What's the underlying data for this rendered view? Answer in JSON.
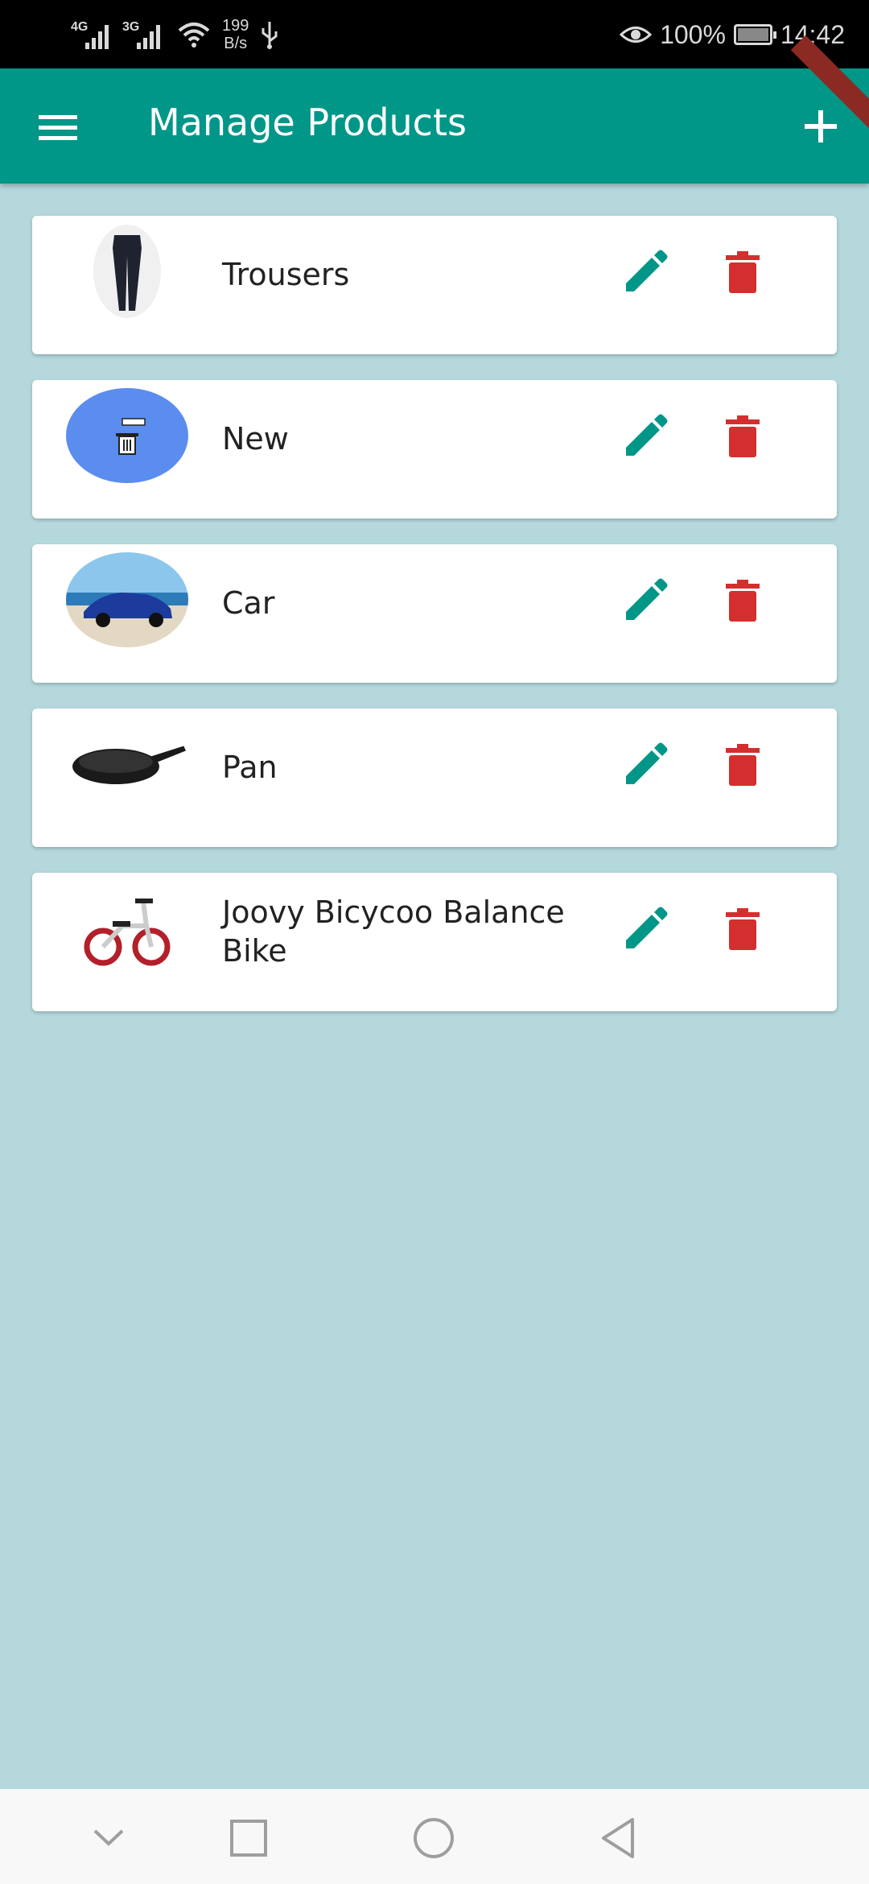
{
  "status_bar": {
    "network_1": "4G",
    "network_2": "3G",
    "speed_value": "199",
    "speed_unit": "B/s",
    "battery": "100%",
    "time": "14:42"
  },
  "app_bar": {
    "title": "Manage Products"
  },
  "products": [
    {
      "name": "Trousers",
      "thumbnail": "trousers-image"
    },
    {
      "name": "New",
      "thumbnail": "placeholder-image"
    },
    {
      "name": "Car",
      "thumbnail": "car-image"
    },
    {
      "name": "Pan",
      "thumbnail": "pan-image"
    },
    {
      "name": "Joovy Bicycoo Balance Bike",
      "thumbnail": "bike-image"
    }
  ],
  "icons": {
    "menu": "menu-icon",
    "add": "plus-icon",
    "edit": "pencil-icon",
    "delete": "trash-icon",
    "nav_down": "chevron-down-icon",
    "nav_recents": "square-icon",
    "nav_home": "circle-icon",
    "nav_back": "triangle-back-icon"
  },
  "colors": {
    "primary": "#009688",
    "background": "#b4d8dc",
    "edit": "#009688",
    "delete": "#d32f2f",
    "placeholder": "#5b8def"
  }
}
